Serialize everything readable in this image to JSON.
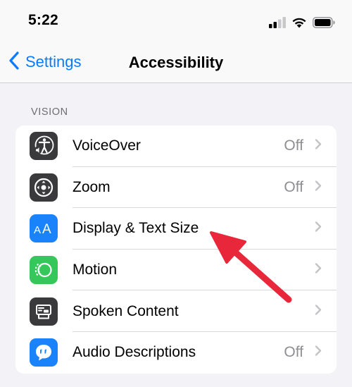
{
  "status_bar": {
    "time": "5:22",
    "icons": [
      "cellular-signal-icon",
      "wifi-icon",
      "battery-icon"
    ]
  },
  "nav": {
    "back_label": "Settings",
    "title": "Accessibility"
  },
  "section": {
    "header": "VISION"
  },
  "rows": [
    {
      "label": "VoiceOver",
      "value": "Off",
      "icon": "voiceover-icon",
      "icon_bg": "#3a3a3c"
    },
    {
      "label": "Zoom",
      "value": "Off",
      "icon": "zoom-icon",
      "icon_bg": "#3a3a3c"
    },
    {
      "label": "Display & Text Size",
      "value": "",
      "icon": "text-size-icon",
      "icon_bg": "#1a82fb"
    },
    {
      "label": "Motion",
      "value": "",
      "icon": "motion-icon",
      "icon_bg": "#35c759"
    },
    {
      "label": "Spoken Content",
      "value": "",
      "icon": "spoken-content-icon",
      "icon_bg": "#3a3a3c"
    },
    {
      "label": "Audio Descriptions",
      "value": "Off",
      "icon": "audio-descriptions-icon",
      "icon_bg": "#1a82fb"
    }
  ],
  "colors": {
    "accent": "#0a7aff",
    "annotation_arrow": "#e8283a",
    "background": "#f2f2f7"
  }
}
